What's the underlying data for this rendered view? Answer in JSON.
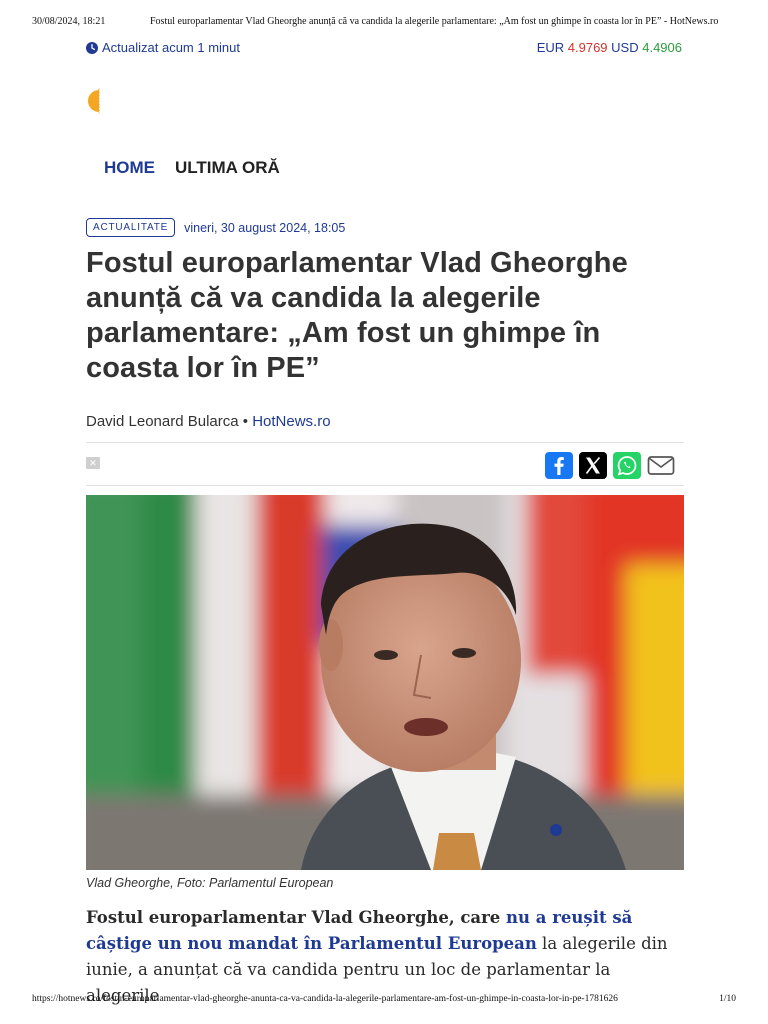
{
  "print": {
    "datetime": "30/08/2024, 18:21",
    "doc_title": "Fostul europarlamentar Vlad Gheorghe anunță că va candida la alegerile parlamentare: „Am fost un ghimpe în coasta lor în PE” - HotNews.ro",
    "url": "https://hotnews.ro/fostul-europarlamentar-vlad-gheorghe-anunta-ca-va-candida-la-alegerile-parlamentare-am-fost-un-ghimpe-in-coasta-lor-in-pe-1781626",
    "page": "1/10"
  },
  "topbar": {
    "updated": "Actualizat acum 1 minut",
    "eur_label": "EUR",
    "eur_value": "4.9769",
    "usd_label": "USD",
    "usd_value": "4.4906"
  },
  "nav": {
    "home": "HOME",
    "latest": "ULTIMA ORĂ"
  },
  "article": {
    "category": "ACTUALITATE",
    "date": "vineri, 30 august 2024, 18:05",
    "headline": "Fostul europarlamentar Vlad Gheorghe anunță că va candida la alegerile parlamentare: „Am fost un ghimpe în coasta lor în PE”",
    "author": "David Leonard Bularca",
    "separator": "•",
    "source": "HotNews.ro",
    "caption": "Vlad Gheorghe, Foto: Parlamentul European",
    "lead_part1": "Fostul europarlamentar Vlad Gheorghe, care ",
    "lead_link": "nu a reușit să câștige un nou mandat în Parlamentul European",
    "lead_part2": " la alegerile din iunie, a anunțat că va candida pentru un loc de parlamentar la alegerile"
  },
  "icons": {
    "updated": "clock-icon",
    "logo": "sun-logo",
    "close": "close-icon",
    "share": [
      "facebook-icon",
      "x-icon",
      "whatsapp-icon",
      "email-icon"
    ]
  },
  "colors": {
    "brand_blue": "#1f3a93",
    "eur_red": "#d0342c",
    "usd_green": "#2e9a3e",
    "logo_orange": "#f5a623"
  }
}
